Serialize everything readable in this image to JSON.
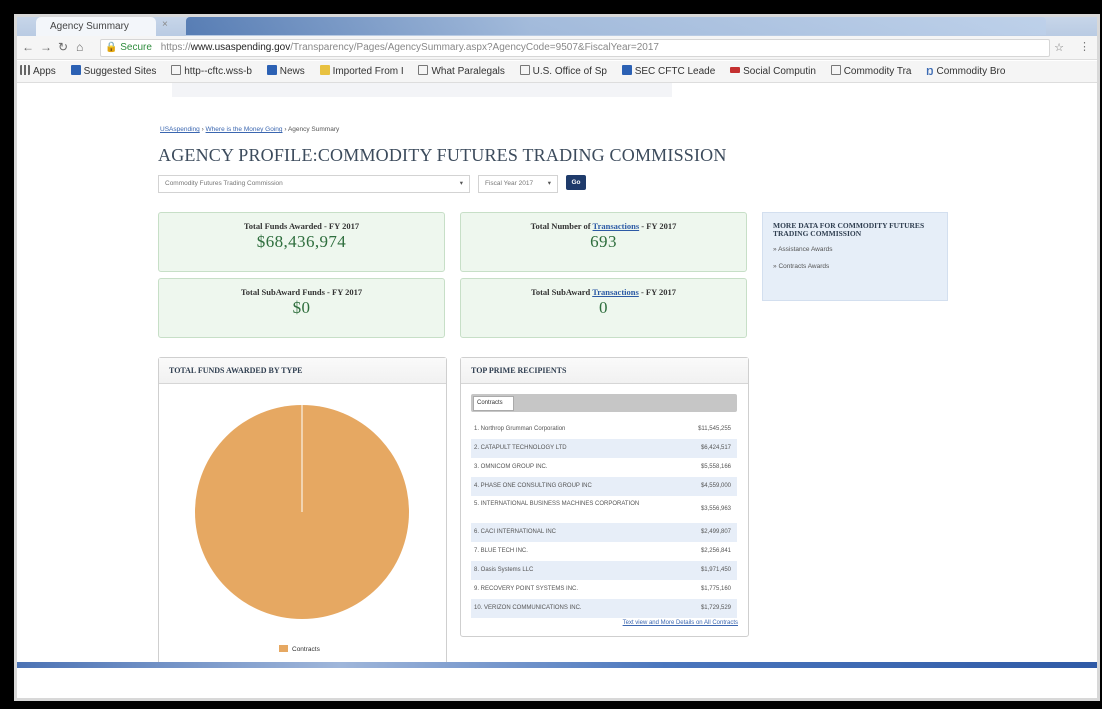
{
  "browser": {
    "tab_title": "Agency Summary",
    "tab_close": "×",
    "secure_label": "Secure",
    "url_prefix": "https://",
    "url_host": "www.usaspending.gov",
    "url_path": "/Transparency/Pages/AgencySummary.aspx?AgencyCode=9507&FiscalYear=2017",
    "star_icon": "☆",
    "menu_icon": "⋮",
    "bookmarks": [
      {
        "label": "Apps",
        "icon": "apps-icon"
      },
      {
        "label": "Suggested Sites",
        "icon": "suggested-icon"
      },
      {
        "label": "http--cftc.wss-b",
        "icon": "page-icon"
      },
      {
        "label": "News",
        "icon": "news-icon"
      },
      {
        "label": "Imported From I",
        "icon": "folder-icon"
      },
      {
        "label": "What Paralegals",
        "icon": "page-icon"
      },
      {
        "label": "U.S. Office of Sp",
        "icon": "page-icon"
      },
      {
        "label": "SEC CFTC Leade",
        "icon": "sec-icon"
      },
      {
        "label": "Social Computin",
        "icon": "social-icon"
      },
      {
        "label": "Commodity Tra",
        "icon": "page-icon"
      },
      {
        "label": "Commodity Bro",
        "icon": "nav-icon"
      }
    ]
  },
  "breadcrumb": {
    "items": [
      "USAspending",
      "Where is the Money Going",
      "Agency Summary"
    ],
    "separator": "›"
  },
  "page_title": "AGENCY PROFILE:COMMODITY FUTURES TRADING COMMISSION",
  "filters": {
    "agency_value": "Commodity Futures Trading Commission",
    "year_value": "Fiscal Year 2017",
    "go_label": "Go"
  },
  "stats": {
    "funds_awarded": {
      "label": "Total Funds Awarded - FY 2017",
      "value": "$68,436,974"
    },
    "transactions": {
      "label_pre": "Total Number of ",
      "label_link": "Transactions",
      "label_post": " - FY 2017",
      "value": "693"
    },
    "subaward_funds": {
      "label": "Total SubAward Funds - FY 2017",
      "value": "$0"
    },
    "subaward_transactions": {
      "label_pre": "Total SubAward ",
      "label_link": "Transactions",
      "label_post": " - FY 2017",
      "value": "0"
    }
  },
  "more_data": {
    "title": "MORE DATA FOR COMMODITY FUTURES TRADING COMMISSION",
    "links": [
      "Assistance Awards",
      "Contracts Awards"
    ],
    "bullet": "»"
  },
  "funds_by_type": {
    "heading": "TOTAL FUNDS AWARDED BY TYPE",
    "legend_label": "Contracts",
    "slices": [
      {
        "label": "Contracts",
        "fraction": 1.0,
        "color": "#e6a862"
      }
    ]
  },
  "top_recipients": {
    "heading": "TOP PRIME RECIPIENTS",
    "tab_label": "Contracts",
    "rows": [
      {
        "name": "1. Northrop Grumman Corporation",
        "amount": "$11,545,255"
      },
      {
        "name": "2. CATAPULT TECHNOLOGY LTD",
        "amount": "$6,424,517"
      },
      {
        "name": "3. OMNICOM GROUP INC.",
        "amount": "$5,558,166"
      },
      {
        "name": "4. PHASE ONE CONSULTING GROUP INC",
        "amount": "$4,559,000"
      },
      {
        "name": "5. INTERNATIONAL BUSINESS MACHINES CORPORATION",
        "amount": "$3,556,963"
      },
      {
        "name": "6. CACI INTERNATIONAL INC",
        "amount": "$2,499,807"
      },
      {
        "name": "7. BLUE TECH INC.",
        "amount": "$2,256,841"
      },
      {
        "name": "8. Oasis Systems LLC",
        "amount": "$1,971,450"
      },
      {
        "name": "9. RECOVERY POINT SYSTEMS INC.",
        "amount": "$1,775,160"
      },
      {
        "name": "10. VERIZON COMMUNICATIONS INC.",
        "amount": "$1,729,529"
      }
    ],
    "view_all": "Text view and More Details on All Contracts"
  },
  "colors": {
    "pie": "#e6a862",
    "stat_value": "#2e6e3d",
    "link": "#3a66b0"
  }
}
